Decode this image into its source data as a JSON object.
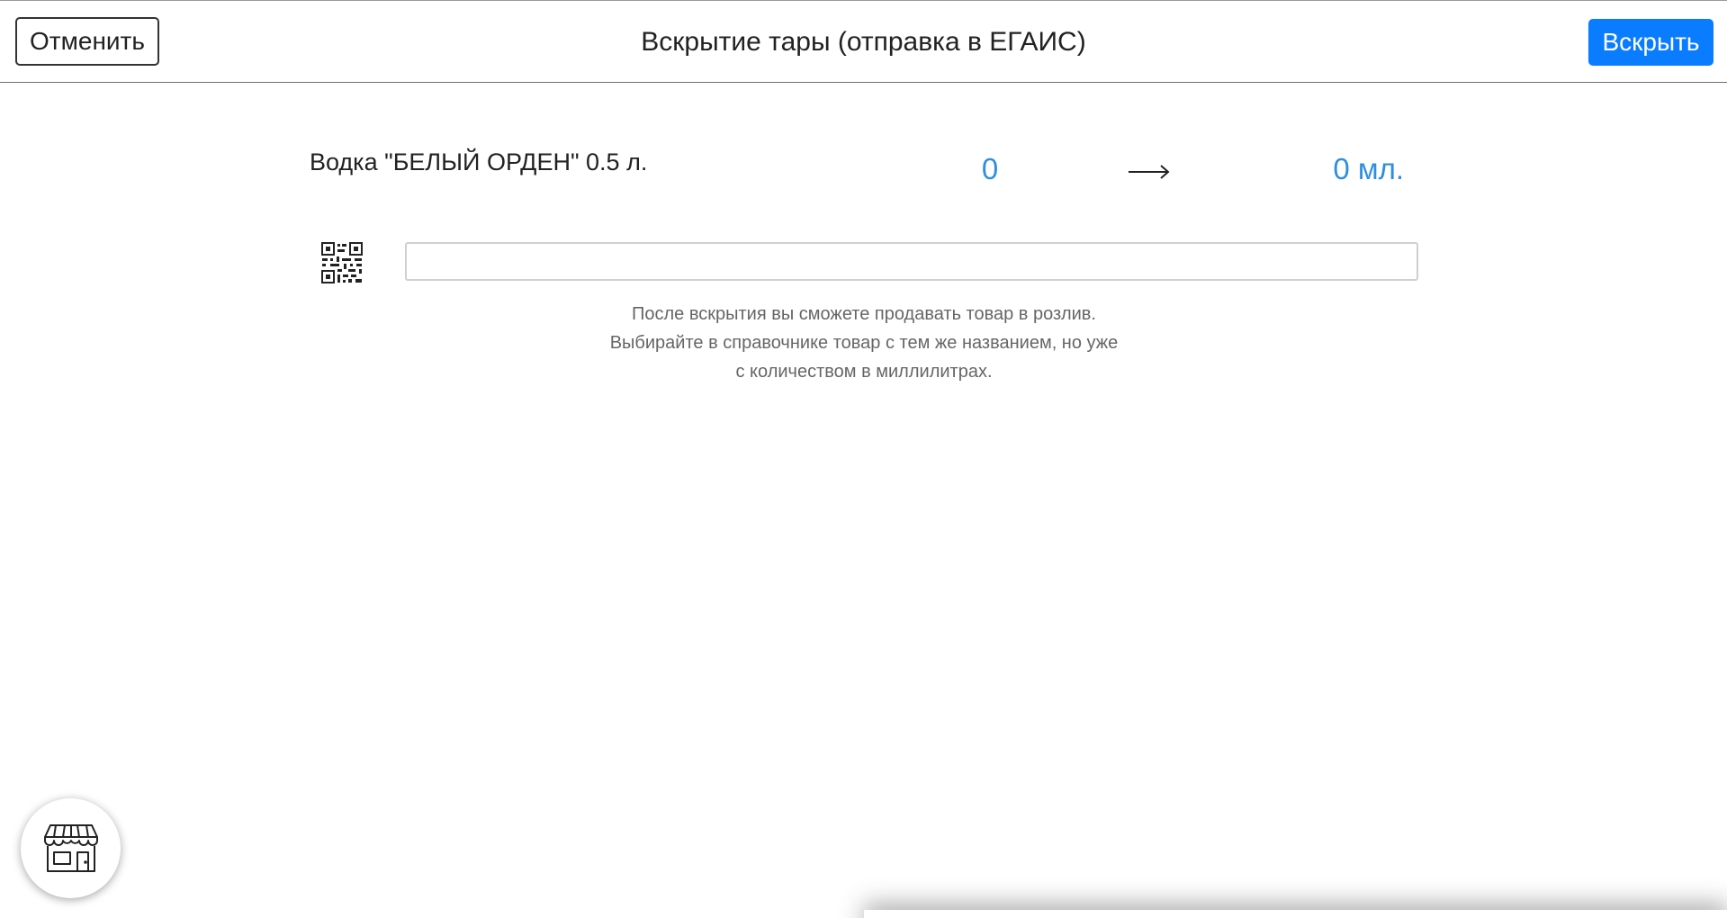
{
  "header": {
    "cancel_label": "Отменить",
    "title": "Вскрытие тары (отправка в ЕГАИС)",
    "open_label": "Вскрыть"
  },
  "product": {
    "name": "Водка \"БЕЛЫЙ ОРДЕН\" 0.5 л.",
    "qty_from": "0",
    "qty_to": "0 мл.",
    "arrow_icon": "arrow-right-icon"
  },
  "scan": {
    "icon": "qr-code-icon",
    "value": "",
    "placeholder": ""
  },
  "hint": {
    "line1": "После вскрытия вы сможете продавать товар в розлив.",
    "line2": "Выбирайте в справочнике товар с тем же названием, но уже",
    "line3": "с количеством в миллилитрах."
  },
  "store_button": {
    "icon": "store-icon"
  },
  "colors": {
    "accent": "#0a7cff",
    "quantity": "#2f8fde",
    "hint_text": "#666666"
  }
}
